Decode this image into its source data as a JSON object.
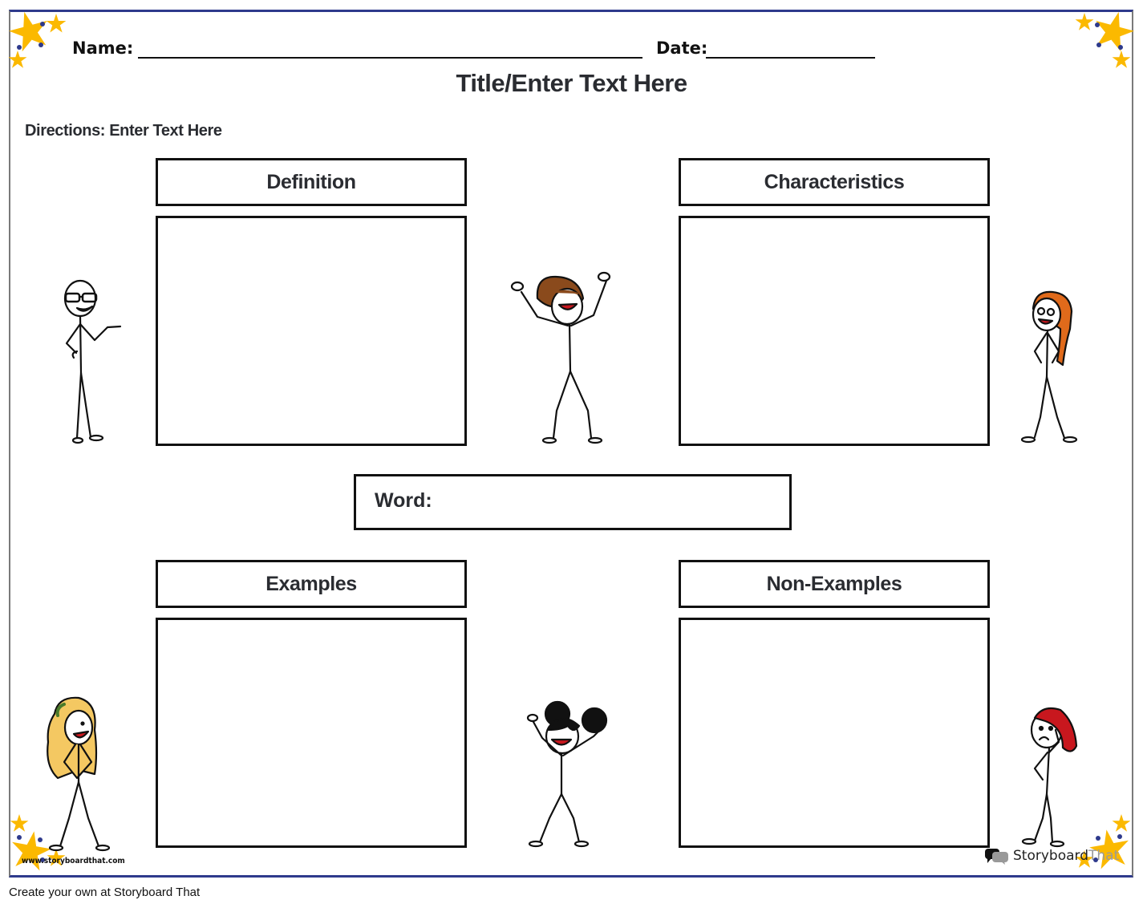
{
  "worksheet": {
    "name_label": "Name:",
    "date_label": "Date:",
    "title": "Title/Enter Text Here",
    "directions": "Directions: Enter Text Here",
    "sections": {
      "definition": {
        "heading": "Definition",
        "content": ""
      },
      "characteristics": {
        "heading": "Characteristics",
        "content": ""
      },
      "examples": {
        "heading": "Examples",
        "content": ""
      },
      "non_examples": {
        "heading": "Non-Examples",
        "content": ""
      }
    },
    "word_label": "Word:",
    "word_value": ""
  },
  "characters": [
    {
      "description": "stick figure with glasses presenting",
      "accent": "#c8171e"
    },
    {
      "description": "stick figure with brown hair cheering",
      "accent": "#8a4a1c"
    },
    {
      "description": "stick figure with orange braided hair",
      "accent": "#e06a1b"
    },
    {
      "description": "stick figure with long blonde hair",
      "accent": "#f4c862"
    },
    {
      "description": "stick figure with black hair buns cheering",
      "accent": "#111111"
    },
    {
      "description": "stick figure with red cap thinking",
      "accent": "#c8171e"
    }
  ],
  "decor": {
    "star_color": "#fbb900",
    "dot_color": "#2e3a8c"
  },
  "watermark": {
    "url": "www.storyboardthat.com",
    "brand_primary": "Storyboard",
    "brand_secondary": "That"
  },
  "footer": {
    "text": "Create your own at Storyboard That"
  }
}
